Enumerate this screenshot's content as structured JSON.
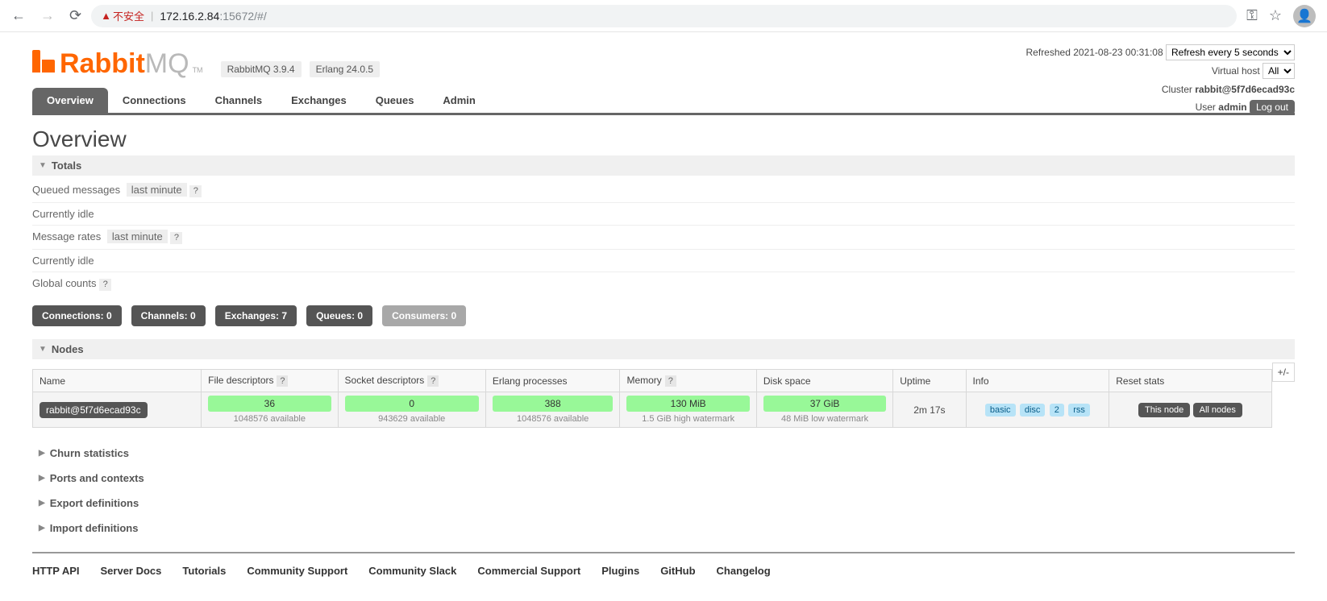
{
  "browser": {
    "insecure_label": "不安全",
    "url_host": "172.16.2.84",
    "url_port_path": ":15672/#/"
  },
  "header": {
    "logo_rabbit": "Rabbit",
    "logo_mq": "MQ",
    "tm": "TM",
    "version_pill": "RabbitMQ 3.9.4",
    "erlang_pill": "Erlang 24.0.5",
    "refreshed_label": "Refreshed 2021-08-23 00:31:08",
    "refresh_select": "Refresh every 5 seconds",
    "vhost_label": "Virtual host",
    "vhost_value": "All",
    "cluster_label": "Cluster",
    "cluster_value": "rabbit@5f7d6ecad93c",
    "user_label": "User",
    "user_value": "admin",
    "logout": "Log out"
  },
  "tabs": {
    "overview": "Overview",
    "connections": "Connections",
    "channels": "Channels",
    "exchanges": "Exchanges",
    "queues": "Queues",
    "admin": "Admin"
  },
  "title": "Overview",
  "sections": {
    "totals": "Totals",
    "nodes": "Nodes",
    "churn": "Churn statistics",
    "ports": "Ports and contexts",
    "export": "Export definitions",
    "import": "Import definitions"
  },
  "totals": {
    "queued_label": "Queued messages",
    "last_minute": "last minute",
    "idle": "Currently idle",
    "rates_label": "Message rates",
    "global_label": "Global counts",
    "help": "?"
  },
  "counts": {
    "connections": "Connections: 0",
    "channels": "Channels: 0",
    "exchanges": "Exchanges: 7",
    "queues": "Queues: 0",
    "consumers": "Consumers: 0"
  },
  "nodes_table": {
    "plusminus": "+/-",
    "headers": {
      "name": "Name",
      "fd": "File descriptors",
      "sd": "Socket descriptors",
      "erl": "Erlang processes",
      "mem": "Memory",
      "disk": "Disk space",
      "uptime": "Uptime",
      "info": "Info",
      "reset": "Reset stats"
    },
    "row": {
      "name": "rabbit@5f7d6ecad93c",
      "fd": "36",
      "fd_sub": "1048576 available",
      "sd": "0",
      "sd_sub": "943629 available",
      "erl": "388",
      "erl_sub": "1048576 available",
      "mem": "130 MiB",
      "mem_sub": "1.5 GiB high watermark",
      "disk": "37 GiB",
      "disk_sub": "48 MiB low watermark",
      "uptime": "2m 17s",
      "info_basic": "basic",
      "info_disc": "disc",
      "info_2": "2",
      "info_rss": "rss",
      "reset_this": "This node",
      "reset_all": "All nodes"
    }
  },
  "footer": {
    "http_api": "HTTP API",
    "server_docs": "Server Docs",
    "tutorials": "Tutorials",
    "comm_support": "Community Support",
    "comm_slack": "Community Slack",
    "commercial": "Commercial Support",
    "plugins": "Plugins",
    "github": "GitHub",
    "changelog": "Changelog"
  }
}
